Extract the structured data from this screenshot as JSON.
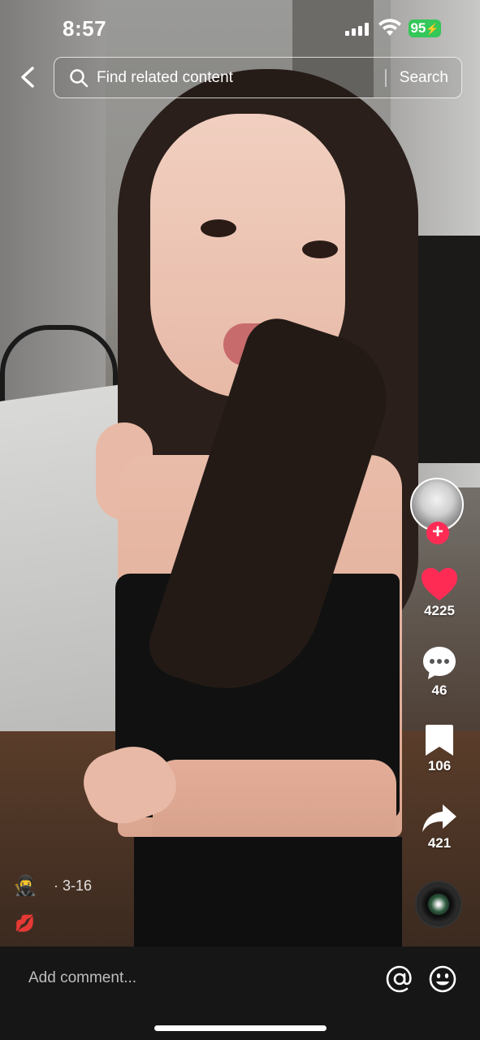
{
  "status_bar": {
    "time": "8:57",
    "battery": "95"
  },
  "search": {
    "placeholder": "Find related content",
    "button_label": "Search"
  },
  "creator": {
    "follow_symbol": "+"
  },
  "actions": {
    "likes": "4225",
    "comments": "46",
    "favorites": "106",
    "shares": "421"
  },
  "video_info": {
    "date": "· 3-16",
    "emoji_1": "🥷",
    "emoji_2": "💋"
  },
  "comment_bar": {
    "placeholder": "Add comment..."
  },
  "colors": {
    "like_red": "#fe2c55",
    "battery_green": "#34c759",
    "comment_bar_bg": "#161616"
  },
  "icons": [
    "back-icon",
    "search-icon",
    "heart-icon",
    "comment-icon",
    "bookmark-icon",
    "share-icon",
    "at-icon",
    "emoji-icon"
  ]
}
